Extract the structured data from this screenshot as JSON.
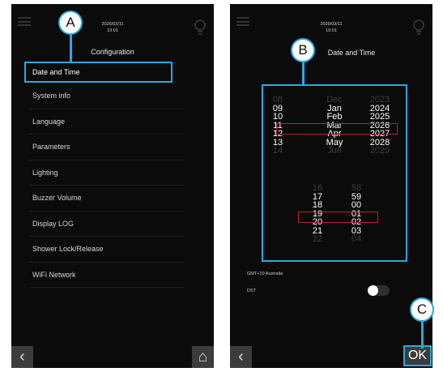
{
  "callouts": {
    "a": "A",
    "b": "B",
    "c": "C"
  },
  "left_screen": {
    "date": "2026/03/11",
    "time": "19:01",
    "title": "Configuration",
    "menu_items": [
      "Date and Time",
      "System info",
      "Language",
      "Parameters",
      "Lighting",
      "Buzzer Volume",
      "Display LOG",
      "Shower Lock/Release",
      "WiFi Network"
    ],
    "back_icon": "‹",
    "home_icon": "⌂"
  },
  "right_screen": {
    "date": "2026/03/11",
    "time": "19:01",
    "title": "Date and Time",
    "day_wheel": [
      "08",
      "09",
      "10",
      "11",
      "12",
      "13",
      "14"
    ],
    "month_wheel": [
      "Dec",
      "Jan",
      "Feb",
      "Mar",
      "Apr",
      "May",
      "Jun"
    ],
    "year_wheel": [
      "2023",
      "2024",
      "2025",
      "2026",
      "2027",
      "2028",
      "2029"
    ],
    "hour_wheel": [
      "16",
      "17",
      "18",
      "19",
      "20",
      "21",
      "22"
    ],
    "minute_wheel": [
      "58",
      "59",
      "00",
      "01",
      "02",
      "03",
      "04"
    ],
    "timezone": "GMT+10 Australia",
    "dst_label": "DST",
    "dst_enabled": false,
    "back_icon": "‹",
    "ok_label": "OK"
  },
  "colors": {
    "accent": "#29a9e1",
    "selection_box": "#b0262e",
    "screen_bg": "#0b0b0b",
    "button_bg": "#3c3c3c"
  }
}
